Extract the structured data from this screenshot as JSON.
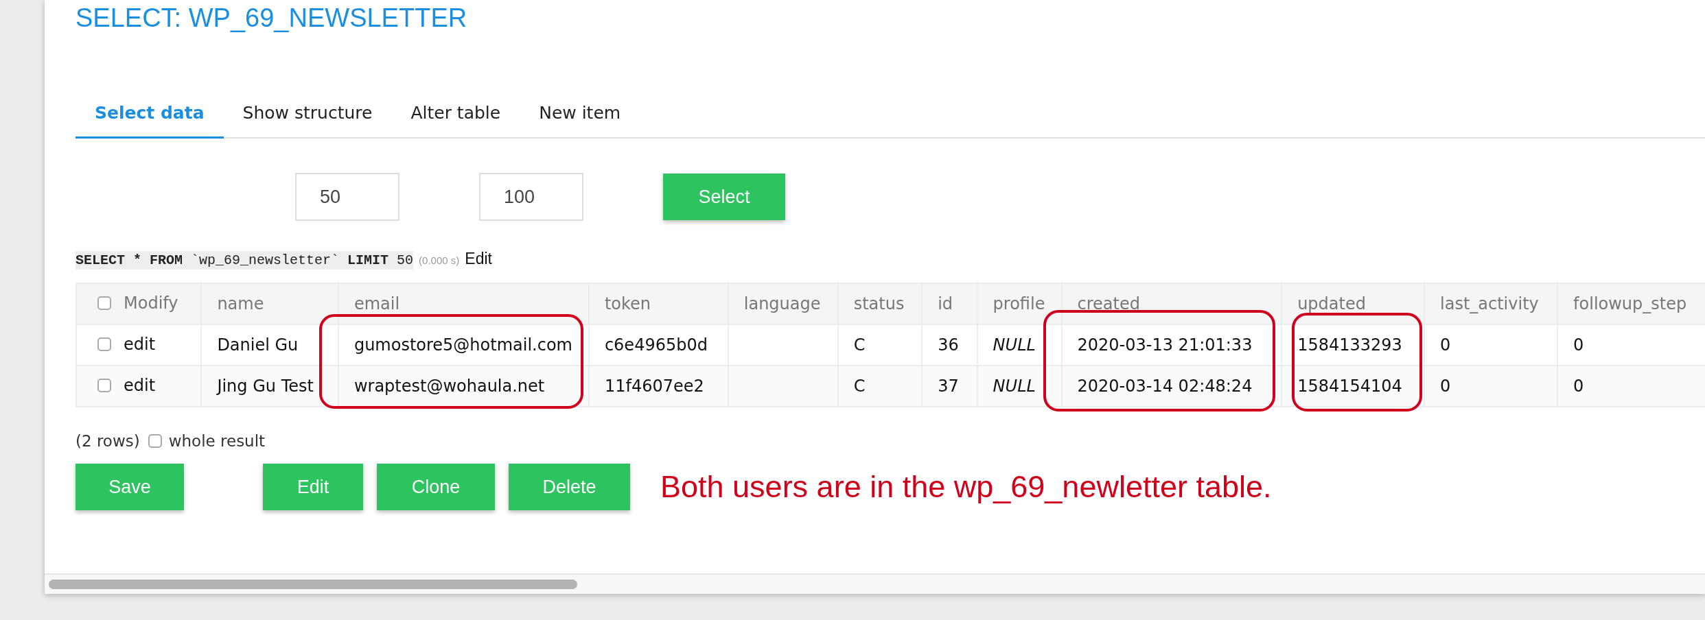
{
  "title": "SELECT: WP_69_NEWSLETTER",
  "tabs": [
    {
      "label": "Select data",
      "selected": true
    },
    {
      "label": "Show structure",
      "selected": false
    },
    {
      "label": "Alter table",
      "selected": false
    },
    {
      "label": "New item",
      "selected": false
    }
  ],
  "inputs": [
    {
      "value": "50"
    },
    {
      "value": "100"
    }
  ],
  "select_button": "Select",
  "query": {
    "sql": "**SELECT * FROM** `wp_69_newsletter` **LIMIT** 50",
    "time": "(0.000 s)",
    "edit_link": "Edit"
  },
  "table": {
    "select_all": {
      "checked": false
    },
    "columns": [
      "Modify",
      "name",
      "email",
      "token",
      "language",
      "status",
      "id",
      "profile",
      "created",
      "updated",
      "last_activity",
      "followup_step"
    ],
    "rows": [
      {
        "checked": false,
        "cells": [
          "edit",
          "Daniel Gu",
          "gumostore5@hotmail.com",
          "c6e4965b0d",
          "",
          "C",
          "36",
          "NULL",
          "2020-03-13 21:01:33",
          "1584133293",
          "0",
          "0"
        ]
      },
      {
        "checked": false,
        "cells": [
          "edit",
          "Jing Gu Test",
          "wraptest@wohaula.net",
          "11f4607ee2",
          "",
          "C",
          "37",
          "NULL",
          "2020-03-14 02:48:24",
          "1584154104",
          "0",
          "0"
        ]
      }
    ]
  },
  "row_count": "(2 rows)",
  "whole_result": {
    "label": "whole result",
    "checked": false
  },
  "buttons": [
    {
      "label": "Save"
    },
    {
      "label": "Edit"
    },
    {
      "label": "Clone"
    },
    {
      "label": "Delete"
    }
  ],
  "annotation": "Both users are in the wp_69_newletter table."
}
